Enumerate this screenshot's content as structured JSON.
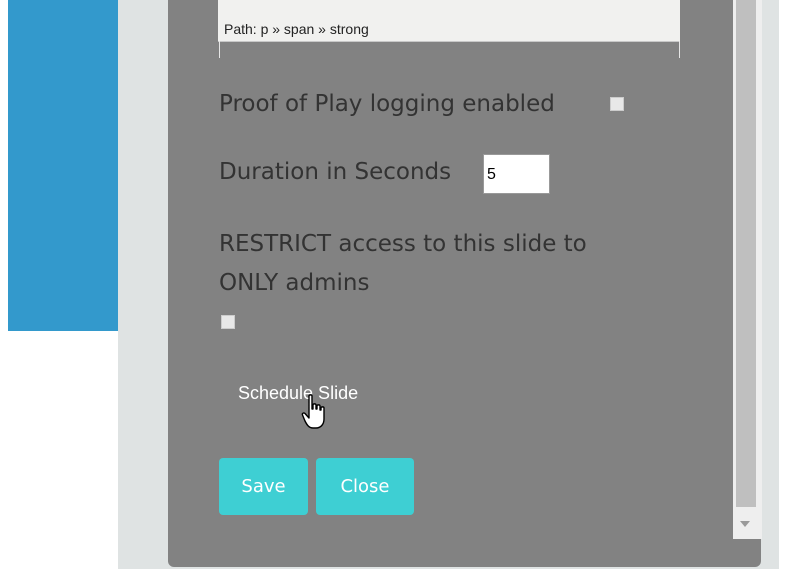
{
  "editor": {
    "path": "Path: p » span » strong"
  },
  "form": {
    "proof_of_play_label": "Proof of Play logging enabled",
    "proof_of_play_checked": false,
    "duration_label": "Duration in Seconds",
    "duration_value": "5",
    "restrict_label_line1": "RESTRICT access to this slide to",
    "restrict_label_line2": "ONLY admins",
    "restrict_checked": false,
    "schedule_link": "Schedule Slide"
  },
  "buttons": {
    "save": "Save",
    "close": "Close"
  },
  "colors": {
    "dialog_background": "#828282",
    "button_accent": "#3ecfd3",
    "side_panel": "#3399cc"
  },
  "icons": {
    "cursor": "hand-pointer-icon",
    "scroll_down": "scroll-down-arrow-icon"
  }
}
